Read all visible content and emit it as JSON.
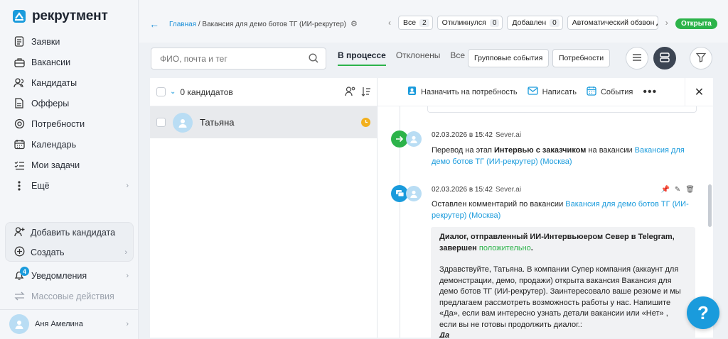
{
  "app": {
    "logo_text": "рекрутмент",
    "brand_color": "#1a9bdc",
    "green": "#2cb34a"
  },
  "sidebar": {
    "items": [
      {
        "label": "Заявки",
        "icon": "file-text-icon"
      },
      {
        "label": "Вакансии",
        "icon": "briefcase-icon"
      },
      {
        "label": "Кандидаты",
        "icon": "users-icon"
      },
      {
        "label": "Офферы",
        "icon": "document-icon"
      },
      {
        "label": "Потребности",
        "icon": "target-icon"
      },
      {
        "label": "Календарь",
        "icon": "calendar-icon"
      },
      {
        "label": "Мои задачи",
        "icon": "checklist-icon"
      },
      {
        "label": "Ещё",
        "icon": "more-vertical-icon"
      }
    ],
    "add_candidate": "Добавить кандидата",
    "create": "Создать",
    "notifications": "Уведомления",
    "notifications_count": "4",
    "mass_actions": "Массовые действия",
    "user_name": "Аня Амелина"
  },
  "header": {
    "breadcrumb_home": "Главная",
    "breadcrumb_sep": " / ",
    "breadcrumb_current": "Вакансия для демо ботов ТГ (ИИ-рекрутер)",
    "filters": [
      {
        "label": "Все",
        "count": "2"
      },
      {
        "label": "Откликнулся",
        "count": "0"
      },
      {
        "label": "Добавлен",
        "count": "0"
      },
      {
        "label": "Автоматический обзвон Д",
        "count": ""
      }
    ],
    "status": "Открыта"
  },
  "toolbar": {
    "search_placeholder": "ФИО, почта и тег",
    "tabs": [
      "В процессе",
      "Отклонены",
      "Все"
    ],
    "group_events": "Групповые события",
    "needs": "Потребности"
  },
  "list": {
    "count_label": "0 кандидатов",
    "candidates": [
      {
        "name": "Татьяна"
      }
    ]
  },
  "detail": {
    "actions": {
      "assign": "Назначить на потребность",
      "write": "Написать",
      "events": "События"
    },
    "events": [
      {
        "date": "02.03.2026 в 15:42",
        "source": "Sever.ai",
        "text_pre": "Перевод на этап ",
        "text_bold": "Интервью с заказчиком",
        "text_mid": " на вакансии ",
        "link": "Вакансия для демо ботов ТГ (ИИ-рекрутер) (Москва)"
      },
      {
        "date": "02.03.2026 в 15:42",
        "source": "Sever.ai",
        "text_pre": "Оставлен комментарий по вакансии ",
        "link": "Вакансия для демо ботов ТГ (ИИ-рекрутер) (Москва)",
        "comment_title": "Диалог, отправленный ИИ-Интервьюером Север в Telegram, завершен ",
        "comment_status": "положительно",
        "comment_dot": ".",
        "comment_body": "Здравствуйте, Татьяна. В компании Супер компания (аккаунт для демонстрации, демо, продажи) открыта вакансия Вакансия для демо ботов ТГ (ИИ-рекрутер). Заинтересовало ваше резюме и мы предлагаем рассмотреть возможность работы у нас. Напишите «Да», если вам интересно узнать детали вакансии или «Нет» , если вы не готовы продолжить диалог.:",
        "comment_answer": "Да"
      }
    ]
  },
  "help": "?"
}
